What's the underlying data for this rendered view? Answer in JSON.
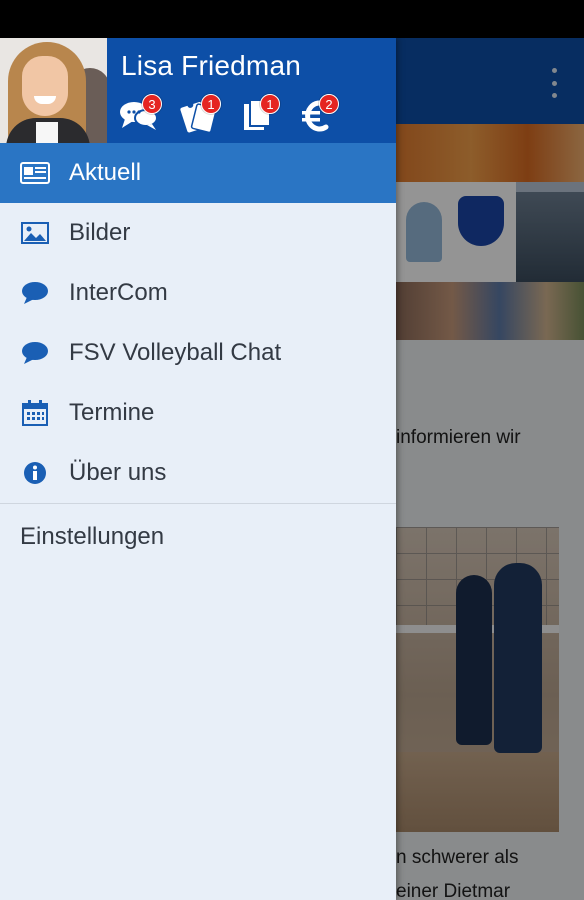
{
  "background": {
    "text_lines": [
      "informieren wir",
      "n schwerer als",
      "einer Dietmar"
    ]
  },
  "drawer": {
    "user_name": "Lisa Friedman",
    "quick_icons": [
      {
        "icon": "chat-bubbles-icon",
        "badge": "3"
      },
      {
        "icon": "tickets-icon",
        "badge": "1"
      },
      {
        "icon": "documents-icon",
        "badge": "1"
      },
      {
        "icon": "euro-icon",
        "badge": "2"
      }
    ],
    "menu": [
      {
        "icon": "newspaper-icon",
        "label": "Aktuell",
        "active": true
      },
      {
        "icon": "image-icon",
        "label": "Bilder"
      },
      {
        "icon": "chat-bubble-icon",
        "label": "InterCom"
      },
      {
        "icon": "chat-bubble-icon",
        "label": "FSV Volleyball Chat"
      },
      {
        "icon": "calendar-icon",
        "label": "Termine"
      },
      {
        "icon": "info-icon",
        "label": "Über uns"
      }
    ],
    "settings_label": "Einstellungen"
  },
  "colors": {
    "header_blue": "#0d4fa7",
    "active_item": "#2a75c4",
    "drawer_bg": "#e8eff8",
    "icon_blue": "#1a5fb4",
    "badge_red": "#e52521"
  }
}
